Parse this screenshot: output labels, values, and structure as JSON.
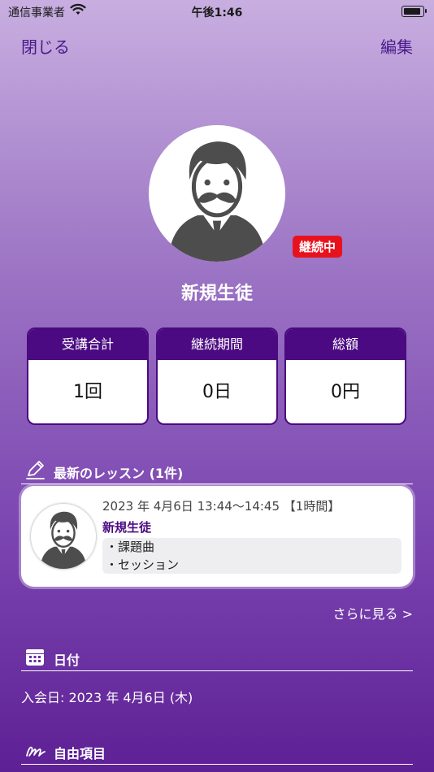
{
  "status_bar": {
    "carrier": "通信事業者",
    "time": "午後1:46"
  },
  "nav": {
    "close_label": "閉じる",
    "edit_label": "編集"
  },
  "profile": {
    "status_badge": "継続中",
    "name": "新規生徒"
  },
  "stats": [
    {
      "label": "受講合計",
      "value": "1回"
    },
    {
      "label": "継続期間",
      "value": "0日"
    },
    {
      "label": "総額",
      "value": "0円"
    }
  ],
  "latest_lessons": {
    "title": "最新のレッスン (1件)",
    "items": [
      {
        "datetime": "2023 年 4月6日 13:44～14:45 【1時間】",
        "student": "新規生徒",
        "songs": [
          "・課題曲",
          "・セッション"
        ]
      }
    ],
    "more_label": "さらに見る >"
  },
  "date_section": {
    "title": "日付",
    "join_date": "入会日: 2023 年 4月6日 (木)"
  },
  "free_section": {
    "title": "自由項目"
  },
  "colors": {
    "accent": "#4b0a82",
    "badge": "#e8121e"
  },
  "icons": [
    "wifi-icon",
    "battery-icon",
    "person-avatar-icon",
    "pencil-icon",
    "calendar-icon",
    "signature-icon"
  ]
}
